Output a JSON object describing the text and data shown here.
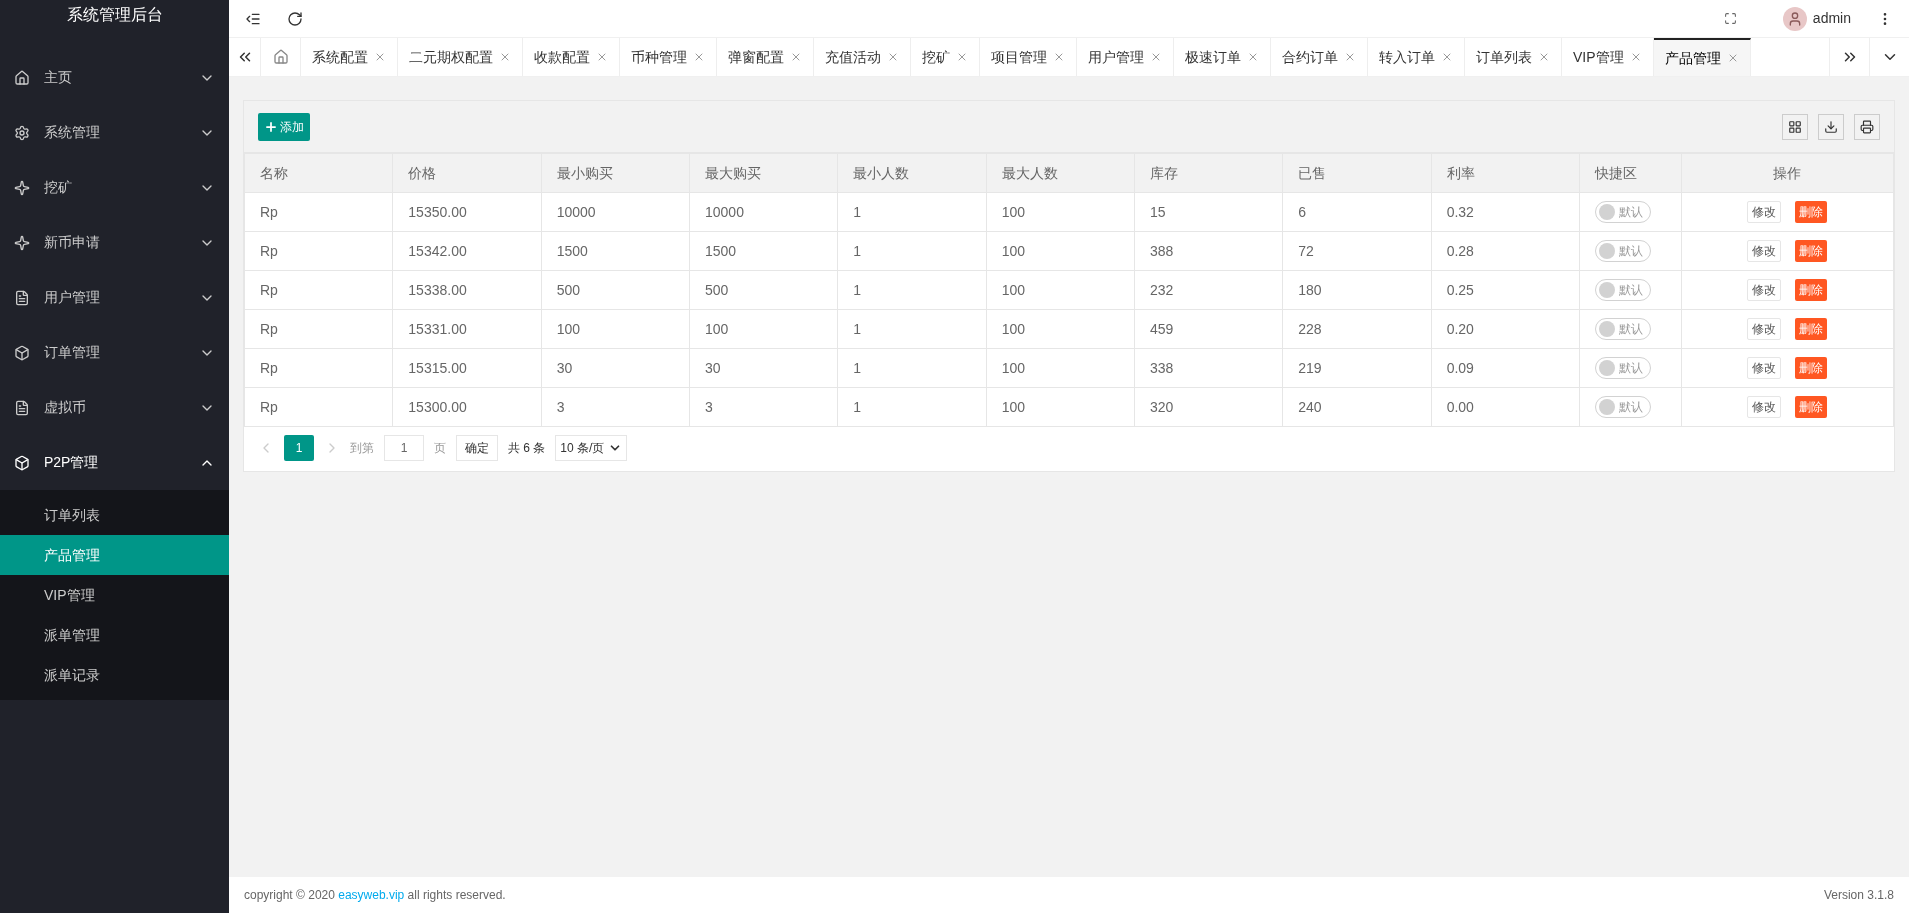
{
  "sidebar": {
    "title": "系统管理后台",
    "items": [
      {
        "label": "主页",
        "expanded": false
      },
      {
        "label": "系统管理",
        "expanded": false
      },
      {
        "label": "挖矿",
        "expanded": false
      },
      {
        "label": "新币申请",
        "expanded": false
      },
      {
        "label": "用户管理",
        "expanded": false
      },
      {
        "label": "订单管理",
        "expanded": false
      },
      {
        "label": "虚拟币",
        "expanded": false
      },
      {
        "label": "P2P管理",
        "expanded": true,
        "children": [
          {
            "label": "订单列表",
            "selected": false
          },
          {
            "label": "产品管理",
            "selected": true
          },
          {
            "label": "VIP管理",
            "selected": false
          },
          {
            "label": "派单管理",
            "selected": false
          },
          {
            "label": "派单记录",
            "selected": false
          }
        ]
      }
    ]
  },
  "header": {
    "user": "admin"
  },
  "tabs": [
    {
      "label": "系统配置",
      "selected": false
    },
    {
      "label": "二元期权配置",
      "selected": false
    },
    {
      "label": "收款配置",
      "selected": false
    },
    {
      "label": "币种管理",
      "selected": false
    },
    {
      "label": "弹窗配置",
      "selected": false
    },
    {
      "label": "充值活动",
      "selected": false
    },
    {
      "label": "挖矿",
      "selected": false
    },
    {
      "label": "项目管理",
      "selected": false
    },
    {
      "label": "用户管理",
      "selected": false
    },
    {
      "label": "极速订单",
      "selected": false
    },
    {
      "label": "合约订单",
      "selected": false
    },
    {
      "label": "转入订单",
      "selected": false
    },
    {
      "label": "订单列表",
      "selected": false
    },
    {
      "label": "VIP管理",
      "selected": false
    },
    {
      "label": "产品管理",
      "selected": true
    }
  ],
  "toolbar": {
    "add_button": "添加"
  },
  "table": {
    "columns": [
      "名称",
      "价格",
      "最小购买",
      "最大购买",
      "最小人数",
      "最大人数",
      "库存",
      "已售",
      "利率",
      "快捷区",
      "操作"
    ],
    "rows": [
      {
        "cells": [
          "Rp",
          "15350.00",
          "10000",
          "10000",
          "1",
          "100",
          "15",
          "6",
          "0.32"
        ],
        "switch": {
          "label": "默认",
          "on": false
        },
        "actions": [
          "修改",
          "删除"
        ]
      },
      {
        "cells": [
          "Rp",
          "15342.00",
          "1500",
          "1500",
          "1",
          "100",
          "388",
          "72",
          "0.28"
        ],
        "switch": {
          "label": "默认",
          "on": false
        },
        "actions": [
          "修改",
          "删除"
        ]
      },
      {
        "cells": [
          "Rp",
          "15338.00",
          "500",
          "500",
          "1",
          "100",
          "232",
          "180",
          "0.25"
        ],
        "switch": {
          "label": "默认",
          "on": false
        },
        "actions": [
          "修改",
          "删除"
        ]
      },
      {
        "cells": [
          "Rp",
          "15331.00",
          "100",
          "100",
          "1",
          "100",
          "459",
          "228",
          "0.20"
        ],
        "switch": {
          "label": "默认",
          "on": false
        },
        "actions": [
          "修改",
          "删除"
        ]
      },
      {
        "cells": [
          "Rp",
          "15315.00",
          "30",
          "30",
          "1",
          "100",
          "338",
          "219",
          "0.09"
        ],
        "switch": {
          "label": "默认",
          "on": false
        },
        "actions": [
          "修改",
          "删除"
        ]
      },
      {
        "cells": [
          "Rp",
          "15300.00",
          "3",
          "3",
          "1",
          "100",
          "320",
          "240",
          "0.00"
        ],
        "switch": {
          "label": "默认",
          "on": false
        },
        "actions": [
          "修改",
          "删除"
        ]
      }
    ]
  },
  "pagination": {
    "pages": [
      {
        "label": "1",
        "selected": true
      }
    ],
    "goto_label": "到第",
    "page_value": "1",
    "page_unit": "页",
    "confirm": "确定",
    "total": "共 6 条",
    "page_size": "10 条/页"
  },
  "footer": {
    "copyright_prefix": "copyright © 2020 ",
    "link": "easyweb.vip",
    "copyright_suffix": " all rights reserved.",
    "version": "Version 3.1.8"
  }
}
